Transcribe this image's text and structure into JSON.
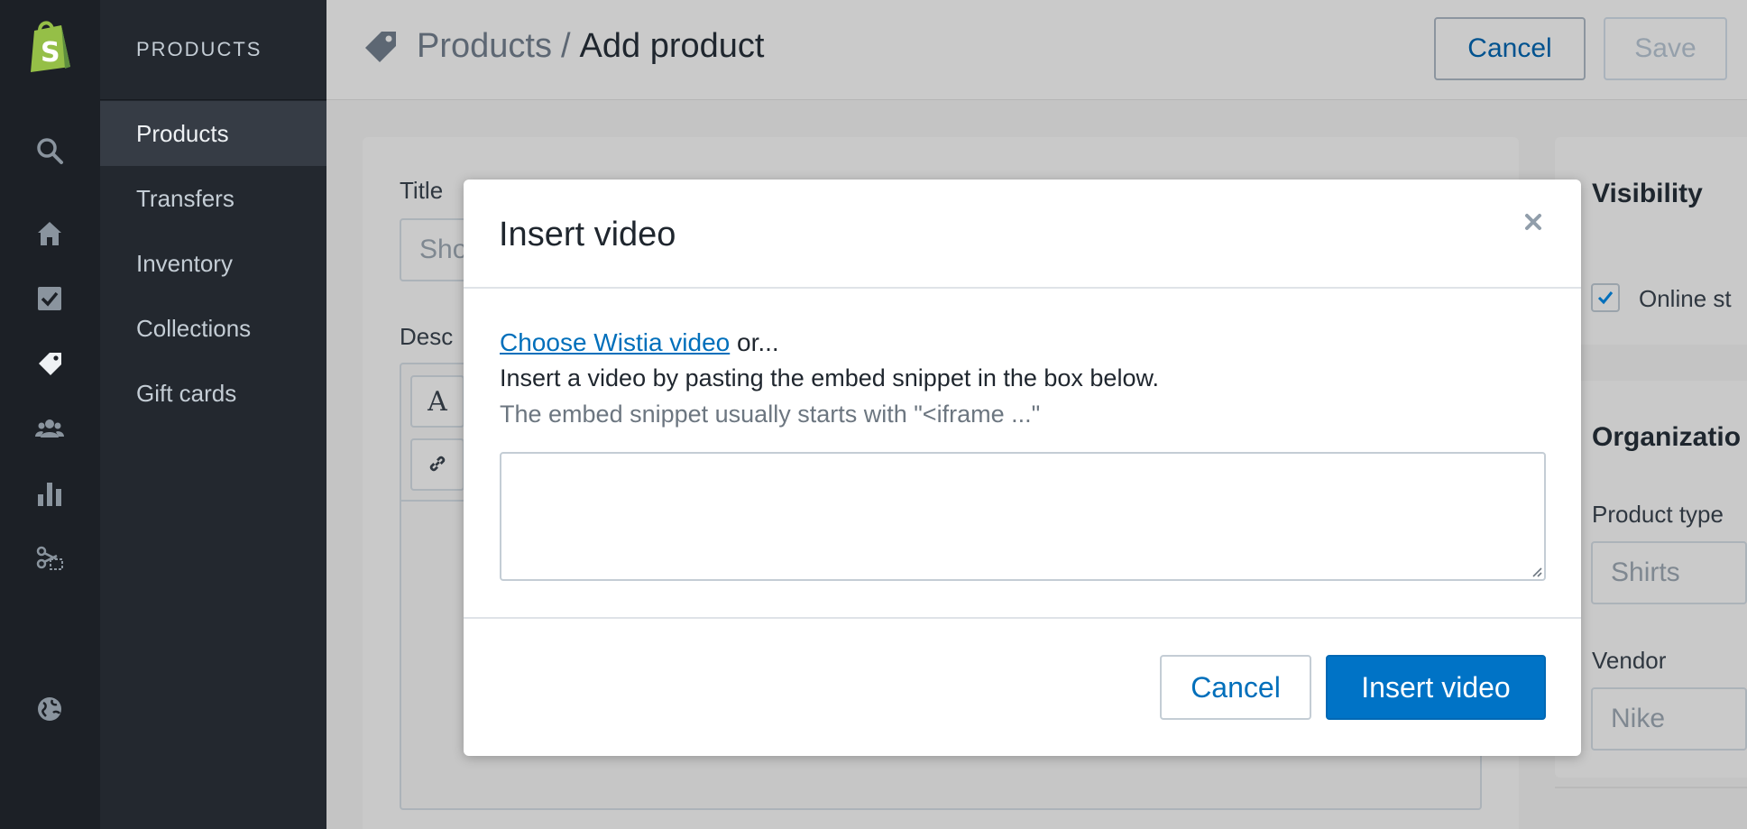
{
  "sidebar": {
    "section_title": "PRODUCTS",
    "items": [
      {
        "label": "Products",
        "active": true
      },
      {
        "label": "Transfers"
      },
      {
        "label": "Inventory"
      },
      {
        "label": "Collections"
      },
      {
        "label": "Gift cards"
      }
    ]
  },
  "rail_icons": [
    "shopify-logo-icon",
    "search-icon",
    "home-icon",
    "orders-icon",
    "products-tag-icon",
    "customers-icon",
    "reports-icon",
    "discounts-icon",
    "online-store-globe-icon"
  ],
  "header": {
    "breadcrumb_parent": "Products",
    "separator": "/",
    "breadcrumb_current": "Add product",
    "cancel_label": "Cancel",
    "save_label": "Save"
  },
  "form": {
    "title_label": "Title",
    "title_placeholder": "Sho",
    "description_label": "Desc",
    "format_button": "A"
  },
  "visibility": {
    "title": "Visibility",
    "online_store_label": "Online st",
    "online_store_checked": true
  },
  "organization": {
    "title": "Organizatio",
    "product_type_label": "Product type",
    "product_type_value": "Shirts",
    "vendor_label": "Vendor",
    "vendor_value": "Nike"
  },
  "modal": {
    "title": "Insert video",
    "choose_link": "Choose Wistia video",
    "choose_suffix": " or...",
    "instruction": "Insert a video by pasting the embed snippet in the box below.",
    "hint": "The embed snippet usually starts with \"<iframe ...\"",
    "snippet_value": "",
    "cancel_label": "Cancel",
    "insert_label": "Insert video"
  },
  "colors": {
    "primary": "#0073c6",
    "link": "#006fbb",
    "sidebar_bg": "#23282f",
    "rail_bg": "#1c2026"
  }
}
